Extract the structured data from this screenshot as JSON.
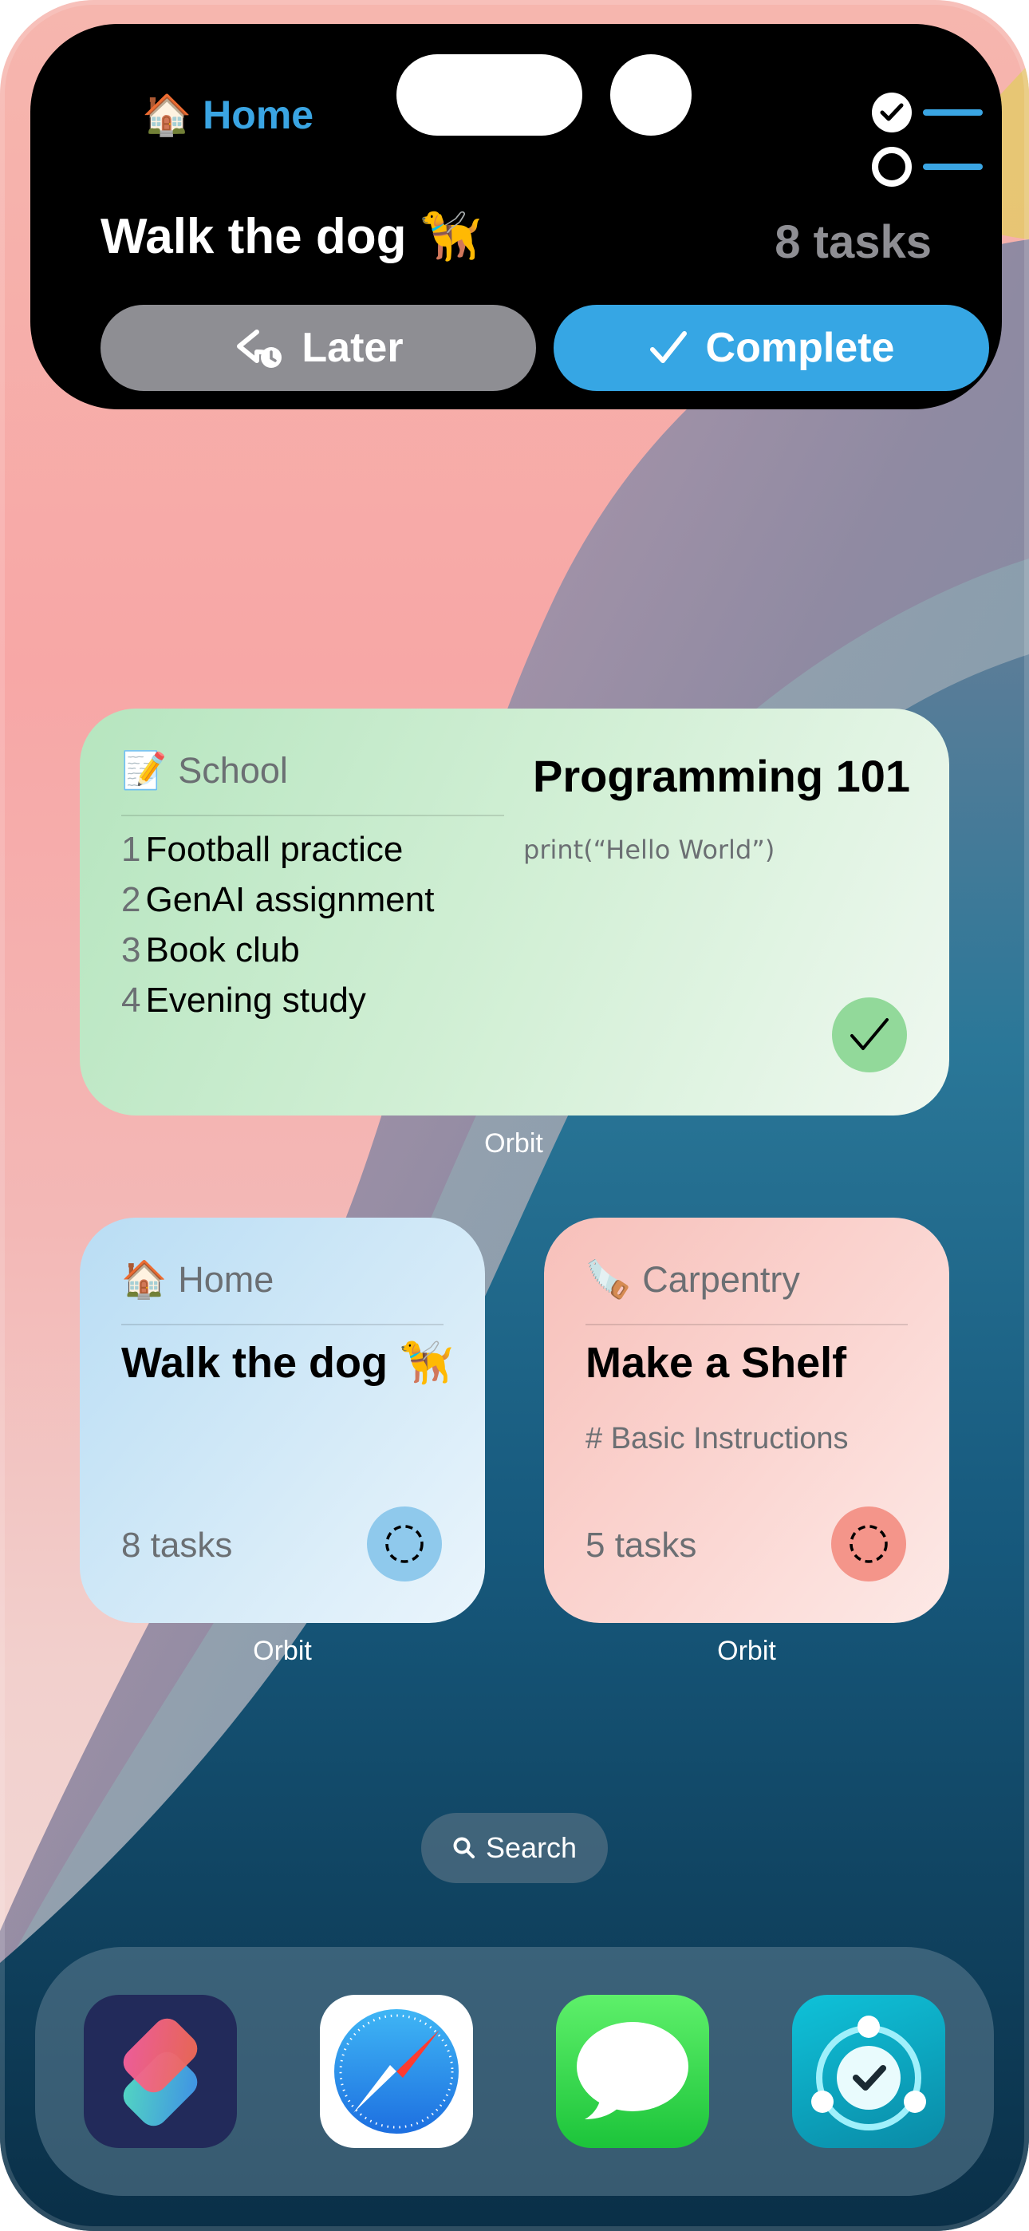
{
  "live_activity": {
    "list_label": "Home",
    "list_emoji": "🏠",
    "task_title": "Walk the dog 🦮",
    "task_count": "8 tasks",
    "later_label": "Later",
    "complete_label": "Complete",
    "accent_color": "#36a6e4"
  },
  "widgets": {
    "school": {
      "emoji": "📝",
      "list_name": "School",
      "items": [
        {
          "num": "1",
          "label": "Football practice"
        },
        {
          "num": "2",
          "label": "GenAI assignment"
        },
        {
          "num": "3",
          "label": "Book club"
        },
        {
          "num": "4",
          "label": "Evening study"
        }
      ],
      "task_title": "Programming 101",
      "task_note": "print(“Hello World”)",
      "app_label": "Orbit"
    },
    "home": {
      "emoji": "🏠",
      "list_name": "Home",
      "task_title": "Walk the dog 🦮",
      "task_count": "8 tasks",
      "app_label": "Orbit"
    },
    "carpentry": {
      "emoji": "🪚",
      "list_name": "Carpentry",
      "task_title": "Make a Shelf",
      "task_note": "# Basic Instructions",
      "task_count": "5 tasks",
      "app_label": "Orbit"
    }
  },
  "search": {
    "label": "Search"
  },
  "dock": {
    "apps": [
      "Shortcuts",
      "Safari",
      "Messages",
      "Orbit"
    ]
  }
}
